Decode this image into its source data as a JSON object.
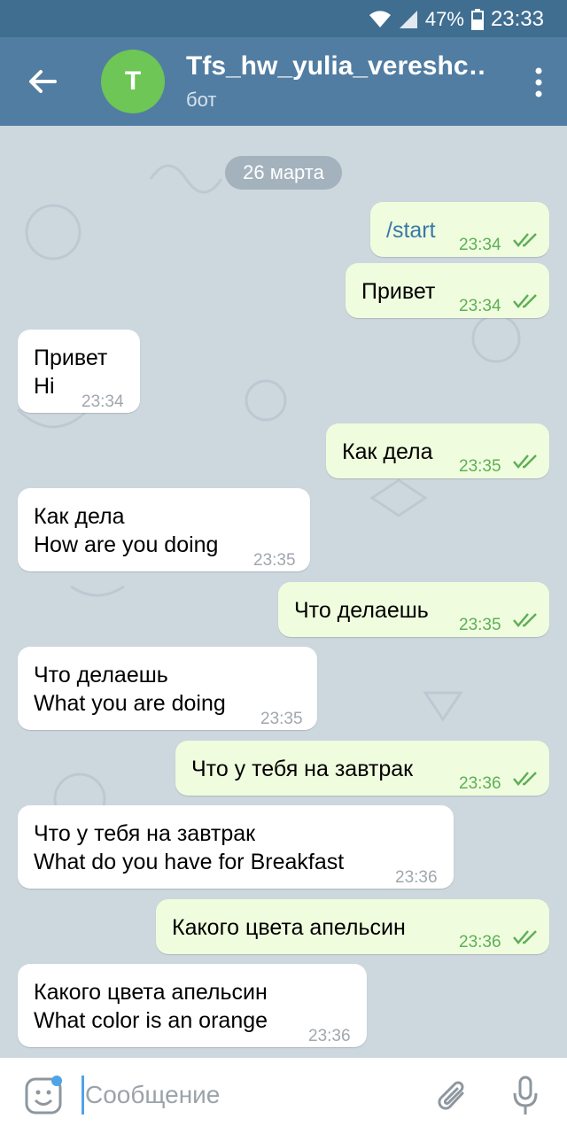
{
  "status_bar": {
    "battery": "47%",
    "time": "23:33",
    "icons": [
      "wifi-icon",
      "signal-icon",
      "battery-icon"
    ]
  },
  "header": {
    "back_icon": "arrow-left-icon",
    "avatar_letter": "T",
    "title": "Tfs_hw_yulia_vereshc…",
    "subtitle": "бот",
    "menu_icon": "more-vertical-icon"
  },
  "chat": {
    "date": "26 марта",
    "messages": [
      {
        "direction": "out",
        "lines": [
          "/start"
        ],
        "time": "23:34",
        "read": true
      },
      {
        "direction": "out",
        "lines": [
          "Привет"
        ],
        "time": "23:34",
        "read": true
      },
      {
        "direction": "in",
        "lines": [
          "Привет",
          "Hi"
        ],
        "time": "23:34"
      },
      {
        "direction": "out",
        "lines": [
          "Как дела"
        ],
        "time": "23:35",
        "read": true
      },
      {
        "direction": "in",
        "lines": [
          "Как дела",
          "How are you doing"
        ],
        "time": "23:35"
      },
      {
        "direction": "out",
        "lines": [
          "Что делаешь"
        ],
        "time": "23:35",
        "read": true
      },
      {
        "direction": "in",
        "lines": [
          "Что делаешь",
          "What you are doing"
        ],
        "time": "23:35"
      },
      {
        "direction": "out",
        "lines": [
          "Что у тебя на завтрак"
        ],
        "time": "23:36",
        "read": true
      },
      {
        "direction": "in",
        "lines": [
          "Что у тебя на завтрак",
          "What do you have for Breakfast"
        ],
        "time": "23:36"
      },
      {
        "direction": "out",
        "lines": [
          "Какого цвета апельсин"
        ],
        "time": "23:36",
        "read": true
      },
      {
        "direction": "in",
        "lines": [
          "Какого цвета апельсин",
          "What color is an orange"
        ],
        "time": "23:36"
      }
    ]
  },
  "composer": {
    "placeholder": "Сообщение",
    "icons": [
      "emoji-icon",
      "attach-icon",
      "mic-icon"
    ]
  },
  "colors": {
    "header": "#517da2",
    "status_bar": "#3f6e91",
    "outgoing_bubble": "#effdde",
    "incoming_bubble": "#ffffff",
    "avatar": "#6dc655",
    "accent": "#4fa3e8"
  }
}
